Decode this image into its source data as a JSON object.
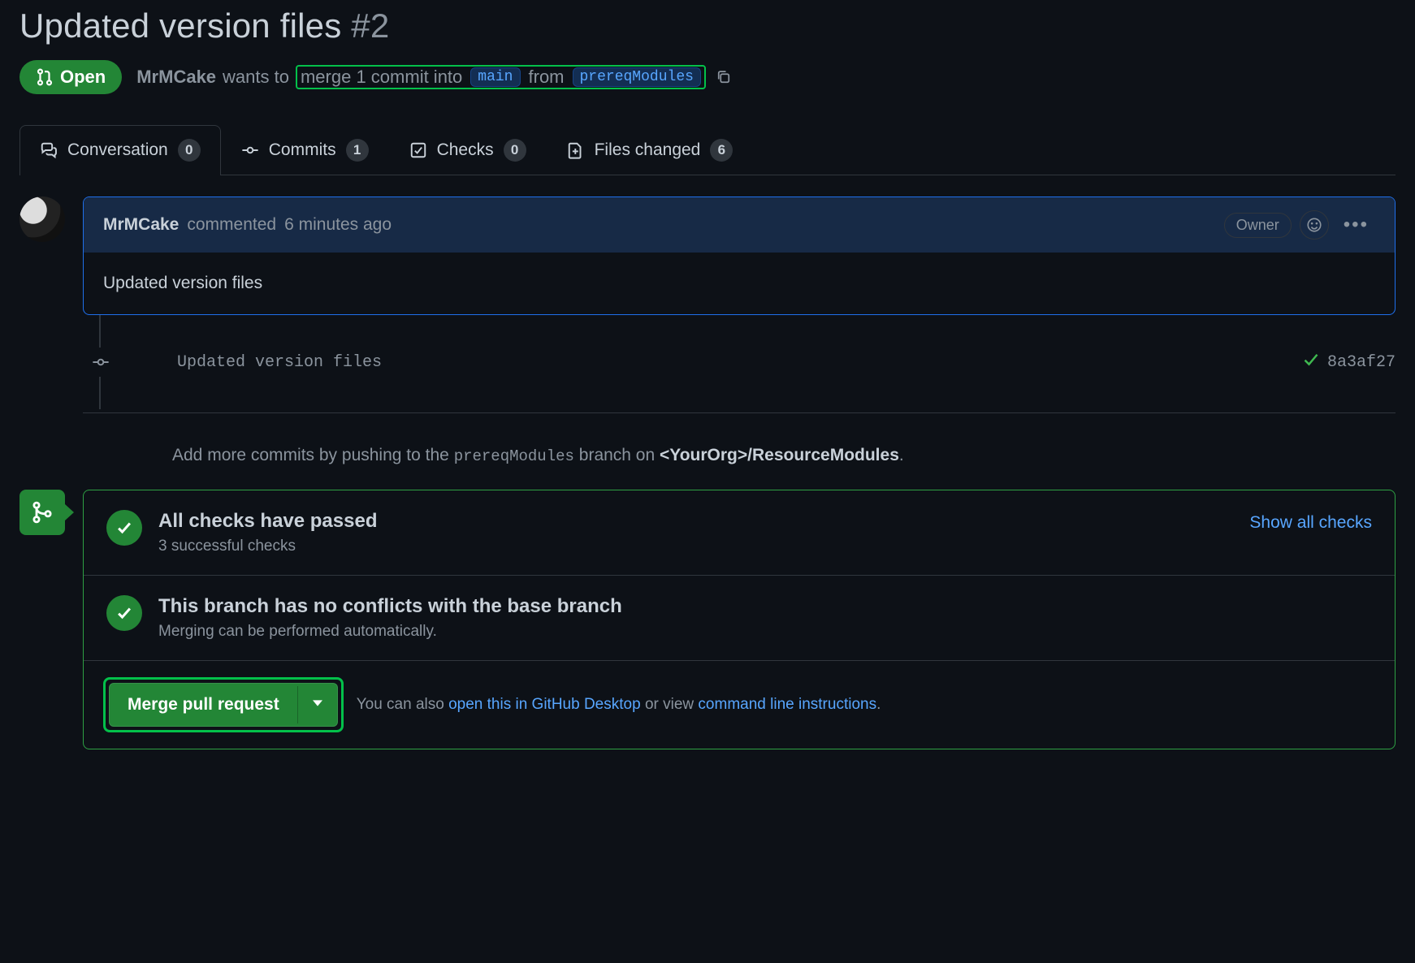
{
  "title": "Updated version files",
  "issue_number": "#2",
  "state": {
    "label": "Open"
  },
  "merge_line": {
    "author": "MrMCake",
    "wants_to": "wants to",
    "merge": "merge 1 commit into",
    "base_branch": "main",
    "from": "from",
    "head_branch": "prereqModules"
  },
  "tabs": {
    "conversation": {
      "label": "Conversation",
      "count": "0"
    },
    "commits": {
      "label": "Commits",
      "count": "1"
    },
    "checks": {
      "label": "Checks",
      "count": "0"
    },
    "files": {
      "label": "Files changed",
      "count": "6"
    }
  },
  "comment": {
    "author": "MrMCake",
    "verb": "commented",
    "time": "6 minutes ago",
    "owner_label": "Owner",
    "body": "Updated version files"
  },
  "commit": {
    "message": "Updated version files",
    "sha": "8a3af27"
  },
  "push_hint": {
    "prefix": "Add more commits by pushing to the",
    "branch": "prereqModules",
    "mid": "branch on",
    "repo": "<YourOrg>/ResourceModules",
    "suffix": "."
  },
  "merge_box": {
    "checks": {
      "title": "All checks have passed",
      "subtitle": "3 successful checks",
      "show_all": "Show all checks"
    },
    "conflicts": {
      "title": "This branch has no conflicts with the base branch",
      "subtitle": "Merging can be performed automatically."
    },
    "footer": {
      "merge_label": "Merge pull request",
      "hint_prefix": "You can also ",
      "hint_link1": "open this in GitHub Desktop",
      "hint_mid": " or view ",
      "hint_link2": "command line instructions",
      "hint_suffix": "."
    }
  }
}
